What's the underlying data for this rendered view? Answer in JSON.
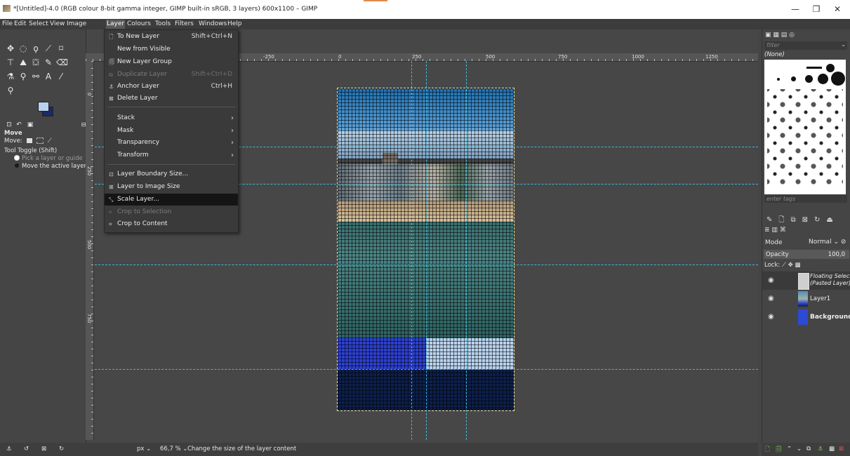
{
  "window": {
    "title": "*[Untitled]-4.0 (RGB colour 8-bit gamma integer, GIMP built-in sRGB, 3 layers) 600x1100 – GIMP",
    "minimize": "—",
    "restore": "❐",
    "close": "✕"
  },
  "menubar": [
    "File",
    "Edit",
    "Select",
    "View",
    "Image",
    "Layer",
    "Colours",
    "Tools",
    "Filters",
    "Windows",
    "Help"
  ],
  "layer_menu": {
    "items": [
      {
        "icon": "new-layer-icon",
        "glyph": "🗋",
        "label": "To New Layer",
        "shortcut": "Shift+Ctrl+N",
        "disabled": false
      },
      {
        "icon": "",
        "glyph": "",
        "label": "New from Visible",
        "shortcut": "",
        "disabled": false
      },
      {
        "icon": "layer-group-icon",
        "glyph": "🗐",
        "label": "New Layer Group",
        "shortcut": "",
        "disabled": false
      },
      {
        "icon": "duplicate-layer-icon",
        "glyph": "⧉",
        "label": "Duplicate Layer",
        "shortcut": "Shift+Ctrl+D",
        "disabled": true
      },
      {
        "icon": "anchor-icon",
        "glyph": "⚓",
        "label": "Anchor Layer",
        "shortcut": "Ctrl+H",
        "disabled": false
      },
      {
        "icon": "delete-layer-icon",
        "glyph": "⊠",
        "label": "Delete Layer",
        "shortcut": "",
        "disabled": false
      }
    ],
    "submenus": [
      "Stack",
      "Mask",
      "Transparency",
      "Transform"
    ],
    "items2": [
      {
        "icon": "layer-boundary-icon",
        "glyph": "⊡",
        "label": "Layer Boundary Size...",
        "disabled": false,
        "highlighted": false
      },
      {
        "icon": "layer-to-image-icon",
        "glyph": "⊞",
        "label": "Layer to Image Size",
        "disabled": false,
        "highlighted": false
      },
      {
        "icon": "scale-layer-icon",
        "glyph": "⤡",
        "label": "Scale Layer...",
        "disabled": false,
        "highlighted": true
      },
      {
        "icon": "crop-selection-icon",
        "glyph": "⌗",
        "label": "Crop to Selection",
        "disabled": true,
        "highlighted": false
      },
      {
        "icon": "crop-content-icon",
        "glyph": "⌗",
        "label": "Crop to Content",
        "disabled": false,
        "highlighted": false
      }
    ]
  },
  "tool_options": {
    "title": "Move",
    "move_label": "Move:",
    "toggle": "Tool Toggle  (Shift)",
    "opt1": "Pick a layer or guide",
    "opt2": "Move the active layer"
  },
  "rulers": {
    "h": [
      "-250",
      "0",
      "250",
      "500",
      "750",
      "1000",
      "1250"
    ],
    "v": [
      "0",
      "250",
      "500",
      "750"
    ]
  },
  "right_dock": {
    "filter_placeholder": "filter",
    "brush_name": "(None)",
    "tags_placeholder": "enter tags",
    "mode_label": "Mode",
    "mode_value": "Normal",
    "opacity_label": "Opacity",
    "opacity_value": "100,0",
    "lock_label": "Lock:",
    "layers": [
      {
        "name": "Floating Selection\n(Pasted Layer)",
        "line1": "Floating Selection",
        "line2": "(Pasted Layer)",
        "thumb": "#e8e8e8",
        "italic": true
      },
      {
        "name": "Layer1",
        "line1": "Layer1",
        "line2": "",
        "thumb": "#5a7fa8",
        "italic": false
      },
      {
        "name": "Background",
        "line1": "Background",
        "line2": "",
        "thumb": "#2c4ad4",
        "italic": false
      }
    ]
  },
  "status": {
    "unit": "px",
    "zoom": "66,7 %",
    "message": "Change the size of the layer content"
  },
  "colors": {
    "accent_blue": "#2c3fcf",
    "light_blue": "#b8d2ee",
    "navy": "#0d1f4a",
    "guide": "#3fbad8"
  }
}
